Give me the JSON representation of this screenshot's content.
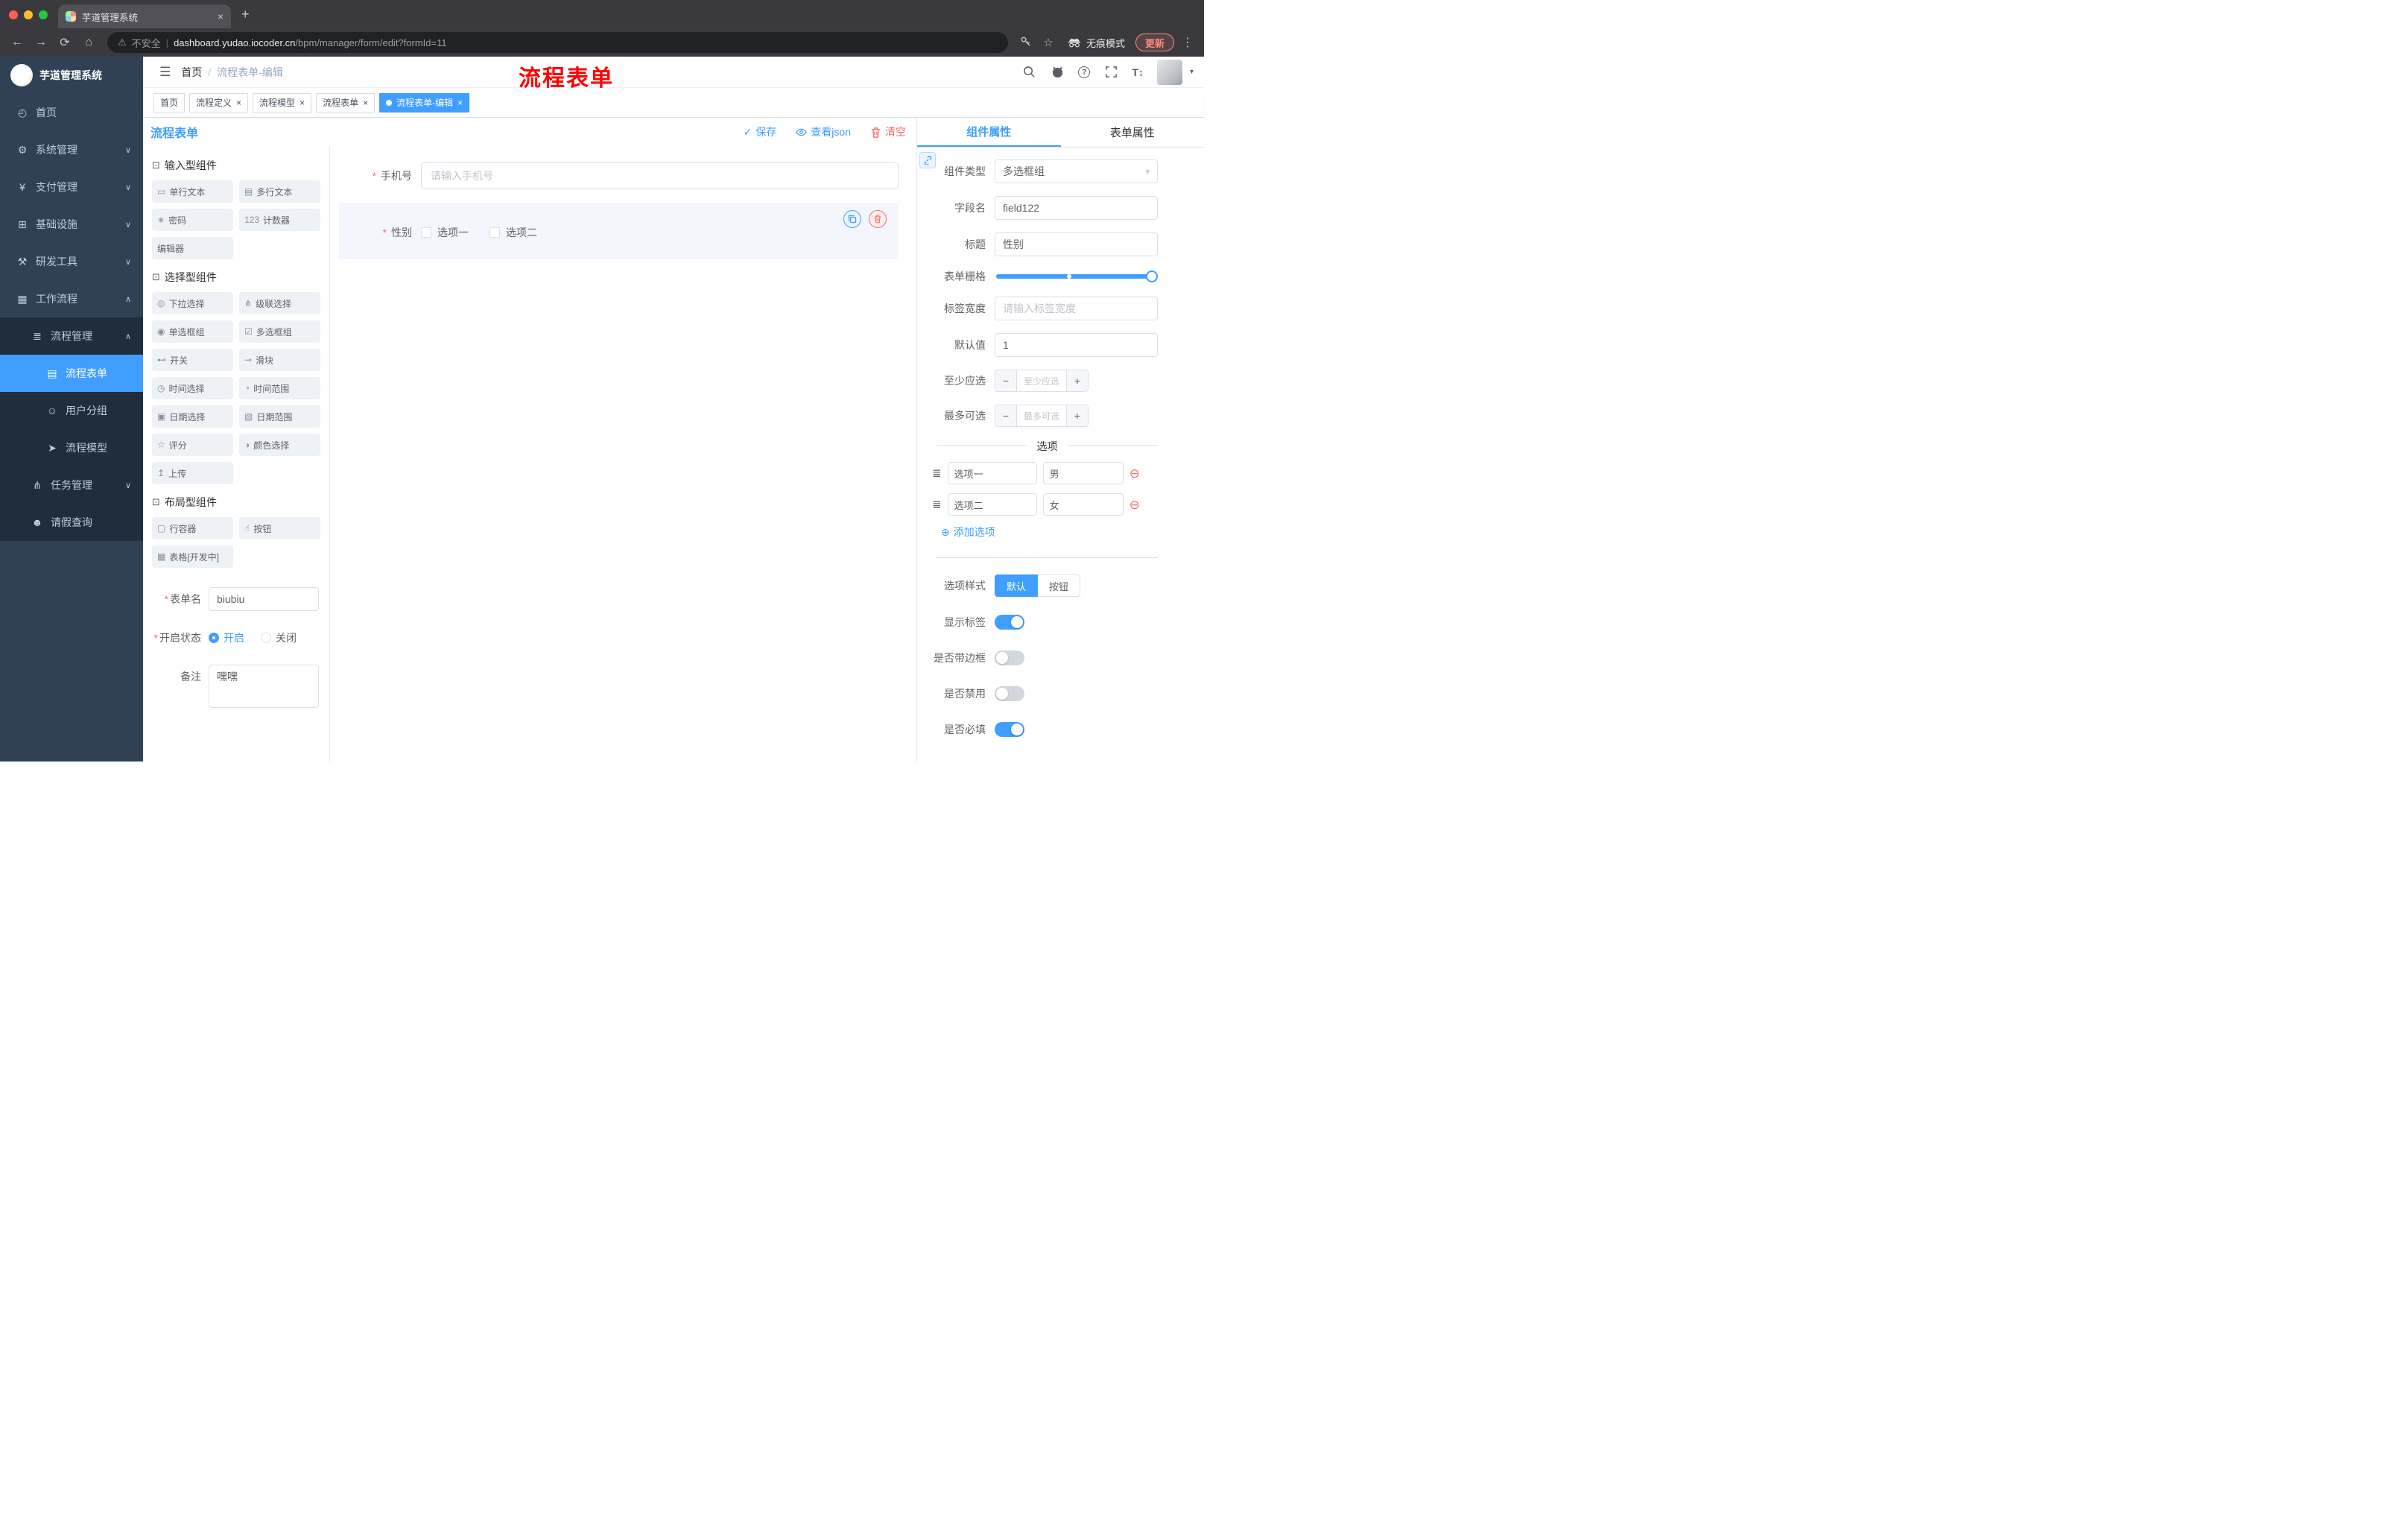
{
  "ui": {
    "required_mark": "*",
    "chevron_down": "∨",
    "chevron_up": "∧",
    "caret_down": "▾",
    "close": "×",
    "check": "✓",
    "plus_circle": "⊕",
    "minus_circle": "⊖",
    "drag_handle": "≣",
    "menu_fold": "☰",
    "dots_menu": "⋮",
    "stepper_minus": "−",
    "stepper_plus": "+",
    "help_glyph": "?",
    "font_size_glyph": "T↕",
    "colors": {
      "primary": "#409eff",
      "danger": "#f56c6c",
      "annotation_red": "#ff0000",
      "sidebar_bg": "#304156",
      "submenu_bg": "#1f2d3d",
      "tag_active": "#409eff"
    }
  },
  "browser": {
    "tab": {
      "title": "芋道管理系统",
      "new_tab": "+"
    },
    "nav": {
      "back": "←",
      "forward": "→",
      "reload": "⟳",
      "home": "⌂"
    },
    "omnibox": {
      "warning_icon": "⚠",
      "security_label": "不安全",
      "divider": "|",
      "host": "dashboard.yudao.iocoder.cn",
      "path": "/bpm/manager/form/edit?formId=11"
    },
    "right": {
      "star_icon": "☆",
      "incognito_label": "无痕模式",
      "update_label": "更新"
    }
  },
  "sidebar": {
    "logo_title": "芋道管理系统",
    "items": [
      {
        "icon": "◴",
        "label": "首页"
      },
      {
        "icon": "⚙",
        "label": "系统管理"
      },
      {
        "icon": "¥",
        "label": "支付管理"
      },
      {
        "icon": "⊞",
        "label": "基础设施"
      },
      {
        "icon": "⚒",
        "label": "研发工具"
      },
      {
        "icon": "▦",
        "label": "工作流程"
      },
      {
        "icon": "≣",
        "label": "流程管理"
      },
      {
        "icon": "▤",
        "label": "流程表单"
      },
      {
        "icon": "☺",
        "label": "用户分组"
      },
      {
        "icon": "➤",
        "label": "流程模型"
      },
      {
        "icon": "⋔",
        "label": "任务管理"
      },
      {
        "icon": "☻",
        "label": "请假查询"
      }
    ]
  },
  "header": {
    "breadcrumb": {
      "first": "首页",
      "separator": "/",
      "current": "流程表单-编辑"
    },
    "annotation": "流程表单"
  },
  "tags": [
    {
      "label": "首页"
    },
    {
      "label": "流程定义"
    },
    {
      "label": "流程模型"
    },
    {
      "label": "流程表单"
    },
    {
      "label": "流程表单-编辑"
    }
  ],
  "designer": {
    "title": "流程表单",
    "actions": {
      "save": "保存",
      "view_json": "查看json",
      "clear": "清空"
    },
    "groups": [
      {
        "icon": "⊡",
        "title": "输入型组件",
        "items": [
          {
            "icon": "▭",
            "label": "单行文本"
          },
          {
            "icon": "▤",
            "label": "多行文本"
          },
          {
            "icon": "∗",
            "label": "密码"
          },
          {
            "icon": "123",
            "label": "计数器"
          },
          {
            "icon": "",
            "label": "编辑器"
          }
        ]
      },
      {
        "icon": "⊡",
        "title": "选择型组件",
        "items": [
          {
            "icon": "◎",
            "label": "下拉选择"
          },
          {
            "icon": "⋔",
            "label": "级联选择"
          },
          {
            "icon": "◉",
            "label": "单选框组"
          },
          {
            "icon": "☑",
            "label": "多选框组"
          },
          {
            "icon": "⊷",
            "label": "开关"
          },
          {
            "icon": "⊸",
            "label": "滑块"
          },
          {
            "icon": "◷",
            "label": "时间选择"
          },
          {
            "icon": "◔",
            "label": "时间范围"
          },
          {
            "icon": "▣",
            "label": "日期选择"
          },
          {
            "icon": "▧",
            "label": "日期范围"
          },
          {
            "icon": "☆",
            "label": "评分"
          },
          {
            "icon": "◑",
            "label": "颜色选择"
          },
          {
            "icon": "↥",
            "label": "上传"
          }
        ]
      },
      {
        "icon": "⊡",
        "title": "布局型组件",
        "items": [
          {
            "icon": "▢",
            "label": "行容器"
          },
          {
            "icon": "☝",
            "label": "按钮"
          },
          {
            "icon": "▦",
            "label": "表格[开发中]"
          }
        ]
      }
    ],
    "meta": {
      "name_label": "表单名",
      "name_value": "biubiu",
      "status_label": "开启状态",
      "status_on": "开启",
      "status_off": "关闭",
      "status_value": "开启",
      "remark_label": "备注",
      "remark_value": "嘿嘿"
    }
  },
  "canvas": {
    "phone_label": "手机号",
    "phone_placeholder": "请输入手机号",
    "gender_label": "性别",
    "gender_options": [
      "选项一",
      "选项二"
    ]
  },
  "props": {
    "tabs": {
      "component": "组件属性",
      "form": "表单属性"
    },
    "active_tab": "组件属性",
    "type_label": "组件类型",
    "type_value": "多选框组",
    "field_label": "字段名",
    "field_value": "field122",
    "title_label": "标题",
    "title_value": "性别",
    "grid_label": "表单栅格",
    "width_label": "标签宽度",
    "width_placeholder": "请输入标签宽度",
    "default_label": "默认值",
    "default_value": "1",
    "min_label": "至少应选",
    "min_placeholder": "至少应选",
    "max_label": "最多可选",
    "max_placeholder": "最多可选",
    "options_divider": "选项",
    "options": [
      {
        "label": "选项一",
        "value": "男"
      },
      {
        "label": "选项二",
        "value": "女"
      }
    ],
    "add_option": "添加选项",
    "style_label": "选项样式",
    "style_default": "默认",
    "style_button": "按钮",
    "style_active": "默认",
    "switches": [
      {
        "label": "显示标签",
        "on": true
      },
      {
        "label": "是否带边框",
        "on": false
      },
      {
        "label": "是否禁用",
        "on": false
      },
      {
        "label": "是否必填",
        "on": true
      }
    ]
  }
}
